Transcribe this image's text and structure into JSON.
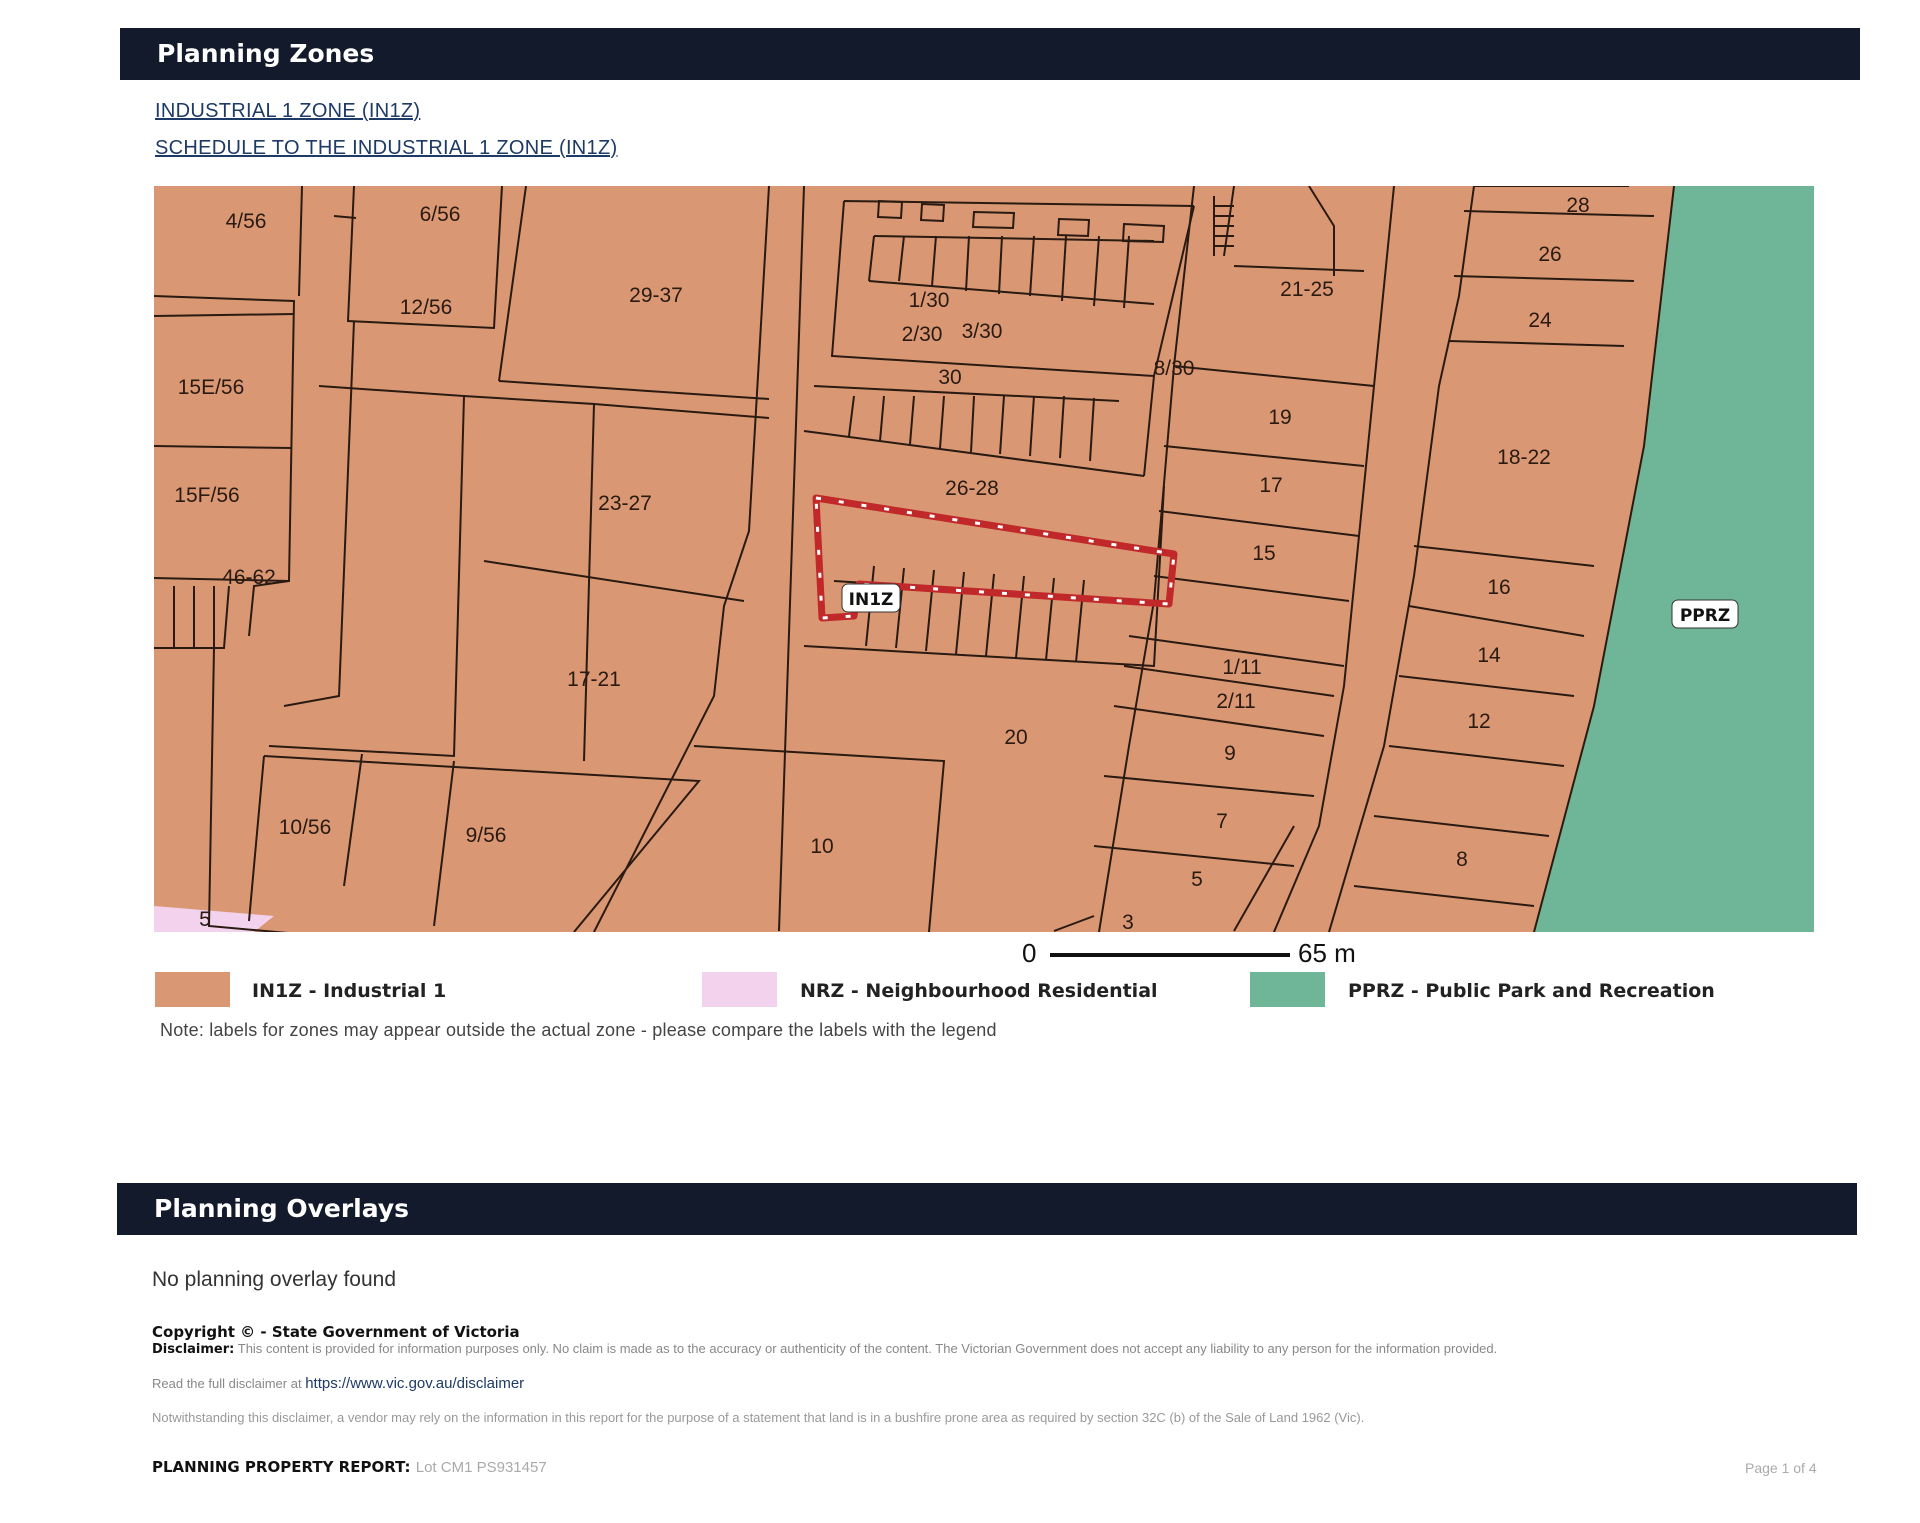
{
  "zones": {
    "title": "Planning Zones",
    "links": [
      "INDUSTRIAL 1 ZONE (IN1Z)",
      "SCHEDULE TO THE INDUSTRIAL 1 ZONE (IN1Z)"
    ],
    "map_zone_labels": [
      "IN1Z",
      "PPRZ"
    ],
    "parcel_labels": [
      "4/56",
      "6/56",
      "12/56",
      "29-37",
      "15E/56",
      "15F/56",
      "46-62",
      "23-27",
      "17-21",
      "10/56",
      "9/56",
      "5",
      "1/30",
      "2/30",
      "3/30",
      "30",
      "8/30",
      "26-28",
      "20",
      "10",
      "3",
      "21-25",
      "19",
      "17",
      "15",
      "1/11",
      "2/11",
      "9",
      "7",
      "5",
      "28",
      "26",
      "24",
      "18-22",
      "16",
      "14",
      "12",
      "8"
    ],
    "scale": {
      "start": "0",
      "end": "65 m"
    },
    "legend": [
      {
        "code": "IN1Z",
        "label": "IN1Z - Industrial 1",
        "color": "#d99873"
      },
      {
        "code": "NRZ",
        "label": "NRZ - Neighbourhood Residential",
        "color": "#f2d2ec"
      },
      {
        "code": "PPRZ",
        "label": "PPRZ - Public Park and Recreation",
        "color": "#6fb597"
      }
    ],
    "note": "Note: labels for zones may appear outside the actual zone - please compare the labels with the legend"
  },
  "overlays": {
    "title": "Planning Overlays",
    "none_text": "No planning overlay found"
  },
  "footer": {
    "copyright": "Copyright © - State Government of Victoria",
    "disclaimer_label": "Disclaimer:",
    "disclaimer_text": "This content is provided for information purposes only. No claim is made as to the accuracy or authenticity of the content. The Victorian Government does not accept any liability to any person for the information provided.",
    "read_full_text": "Read the full disclaimer at",
    "disclaimer_link": "https://www.vic.gov.au/disclaimer",
    "notwithstanding": "Notwithstanding this disclaimer, a vendor may rely on the information in this report for the purpose of a statement that land is in a bushfire prone area as required by section 32C (b) of the Sale of Land 1962 (Vic).",
    "report_label": "PLANNING PROPERTY REPORT:",
    "report_value": "Lot CM1 PS931457",
    "page": "Page 1 of 4"
  },
  "colors": {
    "header_bg": "#131a2b",
    "industrial": "#d99873",
    "residential": "#f2d2ec",
    "park": "#6fb597",
    "property_outline": "#c0282a"
  }
}
